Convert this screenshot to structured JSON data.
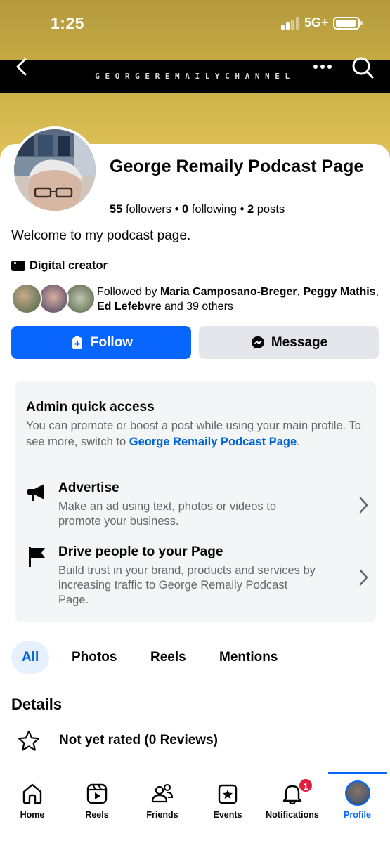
{
  "status_bar": {
    "time": "1:25",
    "network": "5G+"
  },
  "header": {
    "channel_text": "GEORGEREMAILYCHANNEL"
  },
  "profile": {
    "name": "George Remaily Podcast Page",
    "followers_count": "55",
    "followers_label": " followers",
    "following_count": "0",
    "following_label": " following",
    "posts_count": "2",
    "posts_label": " posts",
    "bio": "Welcome to my podcast page.",
    "category": "Digital creator"
  },
  "followed_by": {
    "prefix": "Followed by ",
    "name1": "Maria Camposano-Breger",
    "sep1": ", ",
    "name2": "Peggy Mathis",
    "sep2": ", ",
    "name3": "Ed Lefebvre",
    "suffix": " and 39 others"
  },
  "actions": {
    "follow_label": "Follow",
    "message_label": "Message"
  },
  "admin": {
    "title": "Admin quick access",
    "desc_prefix": "You can promote or boost a post while using your main profile. To see more, switch to ",
    "desc_link": "George Remaily Podcast Page",
    "desc_suffix": ".",
    "items": [
      {
        "title": "Advertise",
        "desc": "Make an ad using text, photos or videos to promote your business.",
        "icon": "megaphone-icon"
      },
      {
        "title": "Drive people to your Page",
        "desc": "Build trust in your brand, products and services by increasing traffic to George Remaily Podcast Page.",
        "icon": "flag-icon"
      }
    ]
  },
  "tabs": [
    {
      "label": "All",
      "active": true
    },
    {
      "label": "Photos",
      "active": false
    },
    {
      "label": "Reels",
      "active": false
    },
    {
      "label": "Mentions",
      "active": false
    }
  ],
  "details": {
    "title": "Details",
    "rating_text": "Not yet rated (0 Reviews)"
  },
  "bottom_nav": [
    {
      "label": "Home",
      "icon": "home-icon"
    },
    {
      "label": "Reels",
      "icon": "reels-icon"
    },
    {
      "label": "Friends",
      "icon": "friends-icon"
    },
    {
      "label": "Events",
      "icon": "events-icon"
    },
    {
      "label": "Notifications",
      "icon": "bell-icon",
      "badge": "1"
    },
    {
      "label": "Profile",
      "icon": "profile-avatar",
      "active": true
    }
  ],
  "colors": {
    "accent": "#0866ff",
    "link": "#0064d1",
    "badge": "#e41e3f",
    "cover_gold": "#c6ab44"
  }
}
